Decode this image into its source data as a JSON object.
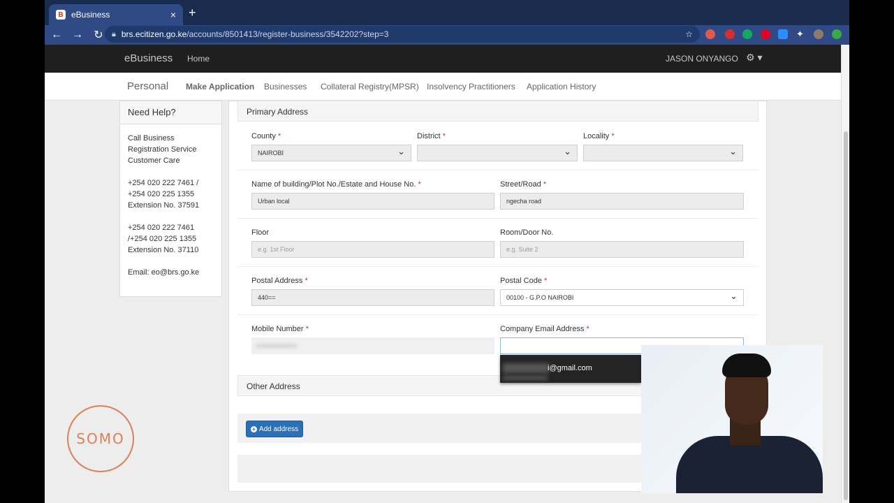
{
  "browser": {
    "tab_title": "eBusiness",
    "tab_favicon": "B",
    "url_host": "brs.ecitizen.go.ke",
    "url_path": "/accounts/8501413/register-business/3542202?step=3",
    "icons": [
      "back-icon",
      "forward-icon",
      "reload-icon",
      "lock-icon",
      "star-icon",
      "extensions-icon"
    ]
  },
  "navbar": {
    "brand": "eBusiness",
    "home": "Home",
    "user": "JASON ONYANGO"
  },
  "subnav": {
    "title": "Personal",
    "links": [
      "Make Application",
      "Businesses",
      "Collateral Registry(MPSR)",
      "Insolvency Practitioners",
      "Application History"
    ]
  },
  "help": {
    "title": "Need Help?",
    "lines": [
      "Call Business",
      "Registration Service",
      "Customer Care",
      "+254 020 222 7461 /",
      "+254 020 225 1355",
      "Extension No. 37591",
      "+254 020 222 7461",
      "/+254 020 225 1355",
      "Extension No. 37110",
      "Email: eo@brs.go.ke"
    ]
  },
  "form": {
    "primary_heading": "Primary Address",
    "county_label": "County",
    "county_value": "NAIROBI",
    "district_label": "District",
    "locality_label": "Locality",
    "building_label": "Name of building/Plot No./Estate and House No.",
    "building_value": "Urban local",
    "street_label": "Street/Road",
    "street_value": "ngecha road",
    "floor_label": "Floor",
    "floor_placeholder": "e.g. 1st Floor",
    "room_label": "Room/Door No.",
    "room_placeholder": "e.g. Suite 2",
    "postal_address_label": "Postal Address",
    "postal_address_value": "440==",
    "postal_code_label": "Postal Code",
    "postal_code_value": "00100 - G.P.O NAIROBI",
    "mobile_label": "Mobile Number",
    "email_label": "Company Email Address",
    "autocomplete_suffix": "i@gmail.com",
    "other_heading": "Other Address",
    "add_address": "Add address",
    "required_mark": "*"
  },
  "overlay": {
    "logo_text": "SOMO"
  },
  "colors": {
    "tab_bar": "#1a2c4e",
    "toolbar": "#2f4a85",
    "navbar": "#1f1f1f",
    "primary_button": "#2b6fb6",
    "required": "#c9302c",
    "logo": "#d9805a"
  }
}
